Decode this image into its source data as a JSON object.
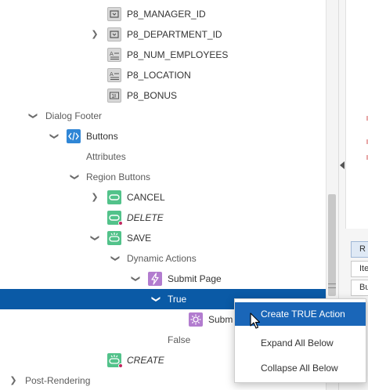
{
  "tree": {
    "nodes": [
      {
        "label": "P8_MANAGER_ID"
      },
      {
        "label": "P8_DEPARTMENT_ID"
      },
      {
        "label": "P8_NUM_EMPLOYEES"
      },
      {
        "label": "P8_LOCATION"
      },
      {
        "label": "P8_BONUS"
      },
      {
        "label": "Dialog Footer"
      },
      {
        "label": "Buttons"
      },
      {
        "label": "Attributes"
      },
      {
        "label": "Region Buttons"
      },
      {
        "label": "CANCEL"
      },
      {
        "label": "DELETE"
      },
      {
        "label": "SAVE"
      },
      {
        "label": "Dynamic Actions"
      },
      {
        "label": "Submit Page"
      },
      {
        "label": "True"
      },
      {
        "label": "Subm"
      },
      {
        "label": "False"
      },
      {
        "label": "CREATE"
      },
      {
        "label": "Post-Rendering"
      }
    ],
    "selected_index": 14
  },
  "context_menu": {
    "items": [
      {
        "label": "Create TRUE Action"
      },
      {
        "label": "Expand All Below"
      },
      {
        "label": "Collapse All Below"
      }
    ],
    "highlighted_index": 0
  },
  "right_panel": {
    "buttons": [
      {
        "label": "R"
      },
      {
        "label": "Ite"
      },
      {
        "label": "Bu"
      }
    ],
    "active_index": 0
  },
  "colors": {
    "selection": "#0a5aa6",
    "menu_highlight": "#1a66b8",
    "button_icon": "#52c28a",
    "region_icon": "#2f86d6",
    "dynamic_action_icon": "#b27ccf",
    "error_dot": "#c1275f"
  }
}
